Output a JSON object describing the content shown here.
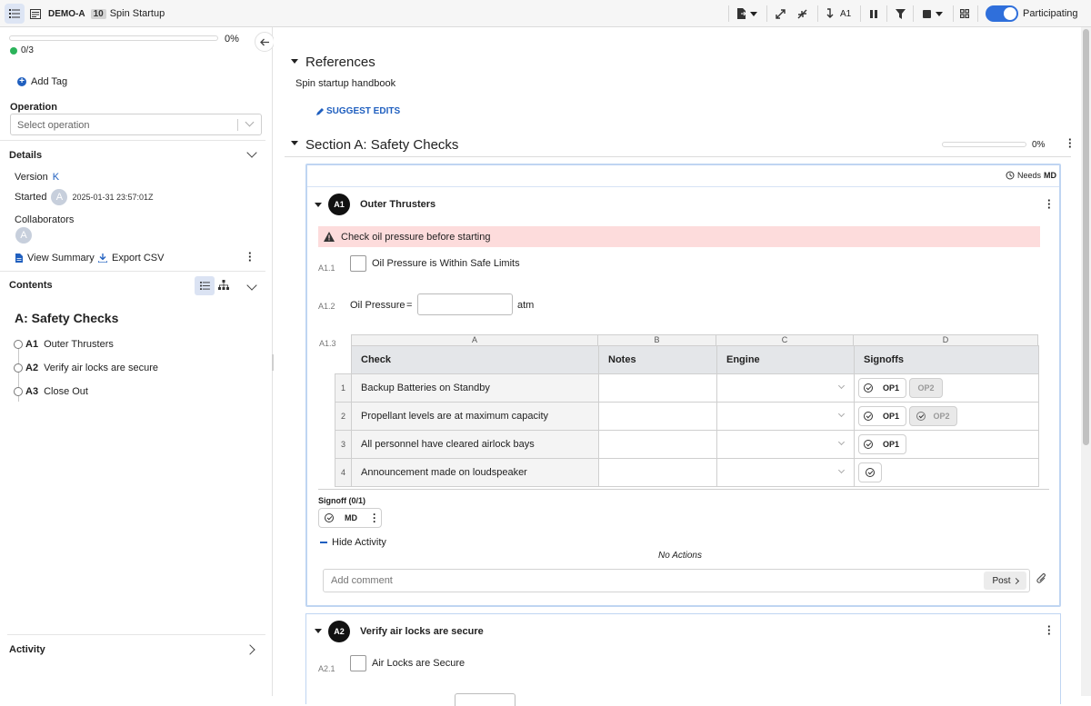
{
  "topbar": {
    "procedure_code": "DEMO-A",
    "run_number": "10",
    "title": "Spin Startup",
    "step_label": "A1",
    "participating_label": "Participating"
  },
  "sidebar": {
    "progress_percent": "0%",
    "progress_value": 0,
    "count": "0/3",
    "add_tag_label": "Add Tag",
    "operation_label": "Operation",
    "operation_placeholder": "Select operation",
    "details_label": "Details",
    "version_label": "Version",
    "version_value": "K",
    "started_label": "Started",
    "started_avatar": "A",
    "started_value": "2025-01-31 23:57:01Z",
    "collaborators_label": "Collaborators",
    "collaborator_avatar": "A",
    "view_summary_label": "View Summary",
    "export_csv_label": "Export CSV",
    "contents_label": "Contents",
    "section_title": "A: Safety Checks",
    "steps": [
      {
        "id": "A1",
        "label": "Outer Thrusters"
      },
      {
        "id": "A2",
        "label": "Verify air locks are secure"
      },
      {
        "id": "A3",
        "label": "Close Out"
      }
    ],
    "activity_label": "Activity"
  },
  "main": {
    "references_title": "References",
    "reference_item": "Spin startup handbook",
    "suggest_edits_label": "SUGGEST EDITS",
    "section_title": "Section A: Safety Checks",
    "section_percent": "0%",
    "section_progress_value": 0,
    "needs_label": "Needs",
    "needs_role": "MD",
    "step1": {
      "badge": "A1",
      "title": "Outer Thrusters",
      "warning": "Check oil pressure before starting",
      "item1_num": "A1.1",
      "item1_label": "Oil Pressure is Within Safe Limits",
      "item2_num": "A1.2",
      "item2_label": "Oil Pressure",
      "item2_eq": "=",
      "item2_value": "",
      "item2_unit": "atm",
      "item3_num": "A1.3",
      "table": {
        "col_letters": [
          "A",
          "B",
          "C",
          "D"
        ],
        "headers": [
          "Check",
          "Notes",
          "Engine",
          "Signoffs"
        ],
        "rows": [
          {
            "n": "1",
            "check": "Backup Batteries on Standby"
          },
          {
            "n": "2",
            "check": "Propellant levels are at maximum capacity"
          },
          {
            "n": "3",
            "check": "All personnel have cleared airlock bays"
          },
          {
            "n": "4",
            "check": "Announcement made on loudspeaker"
          }
        ],
        "signoff_op1": "OP1",
        "signoff_op2": "OP2"
      },
      "signoff_label": "Signoff (0/1)",
      "signoff_role": "MD",
      "hide_activity_label": "Hide Activity",
      "no_actions": "No Actions",
      "comment_placeholder": "Add comment",
      "post_label": "Post"
    },
    "step2": {
      "badge": "A2",
      "title": "Verify air locks are secure",
      "item1_num": "A2.1",
      "item1_label": "Air Locks are Secure"
    }
  },
  "colors": {
    "accent": "#1f5fbf",
    "toggle": "#2f6fdb",
    "warning_bg": "#fddcdc",
    "success": "#2bb35a"
  }
}
